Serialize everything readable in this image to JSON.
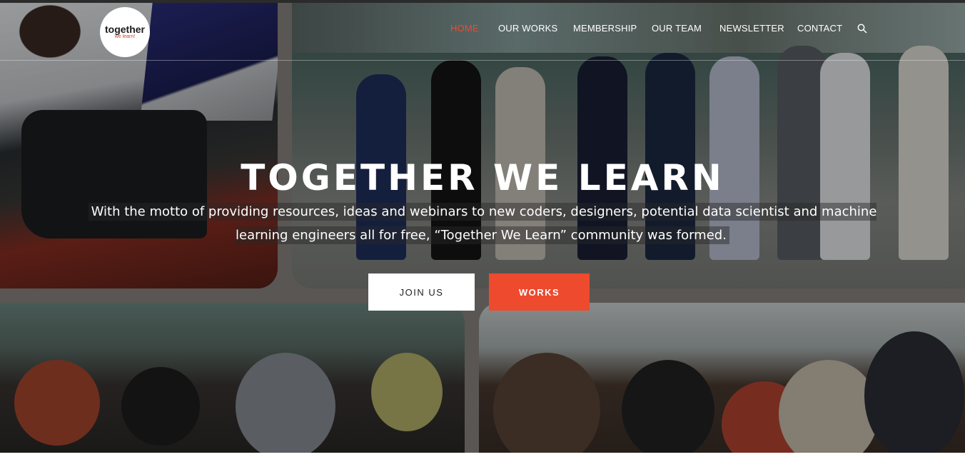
{
  "brand": {
    "logo_main": "together",
    "logo_sub": "we learn!"
  },
  "nav": {
    "items": [
      {
        "label": "HOME",
        "active": true
      },
      {
        "label": "OUR WORKS",
        "active": false
      },
      {
        "label": "MEMBERSHIP",
        "active": false
      },
      {
        "label": "OUR TEAM",
        "active": false
      },
      {
        "label": "NEWSLETTER",
        "active": false
      },
      {
        "label": "CONTACT",
        "active": false
      }
    ],
    "search_icon": "search-icon"
  },
  "hero": {
    "title": "TOGETHER WE LEARN",
    "description": "With the motto of providing resources, ideas and webinars to new coders, designers, potential data scientist and machine learning engineers all for free, “Together We Learn” community was formed.",
    "join_label": "JOIN US",
    "works_label": "WORKS"
  },
  "colors": {
    "accent": "#ee4a2e",
    "text_light": "#ffffff"
  }
}
